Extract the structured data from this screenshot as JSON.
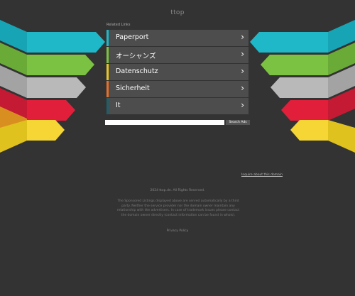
{
  "header": {
    "site_title": "ttop"
  },
  "related_label": "Related Links",
  "links": [
    {
      "label": "Paperport",
      "accent": "#1fb8c9"
    },
    {
      "label": "オーシャンズ",
      "accent": "#7cc242"
    },
    {
      "label": "Datenschutz",
      "accent": "#e8c62a"
    },
    {
      "label": "Sicherheit",
      "accent": "#e8702a"
    },
    {
      "label": "It",
      "accent": "#1f5f6a"
    }
  ],
  "chevron": "›",
  "search": {
    "value": "",
    "placeholder": "",
    "button_label": "Search Ads"
  },
  "inquire_link": "Inquire about this domain",
  "footer": {
    "copyright": "2024 ttop.de. All Rights Reserved.",
    "disclaimer": "The Sponsored Listings displayed above are served automatically by a third party. Neither the service provider nor the domain owner maintain any relationship with the advertisers. In case of trademark issues please contact the domain owner directly (contact information can be found in whois).",
    "privacy": "Privacy Policy"
  },
  "colors": {
    "background": "#333333",
    "cyan": "#1fb8c9",
    "green": "#7cc242",
    "gray": "#b9b9b9",
    "red": "#e21f3b",
    "orange": "#f2a52b",
    "yellow": "#f5d634"
  }
}
